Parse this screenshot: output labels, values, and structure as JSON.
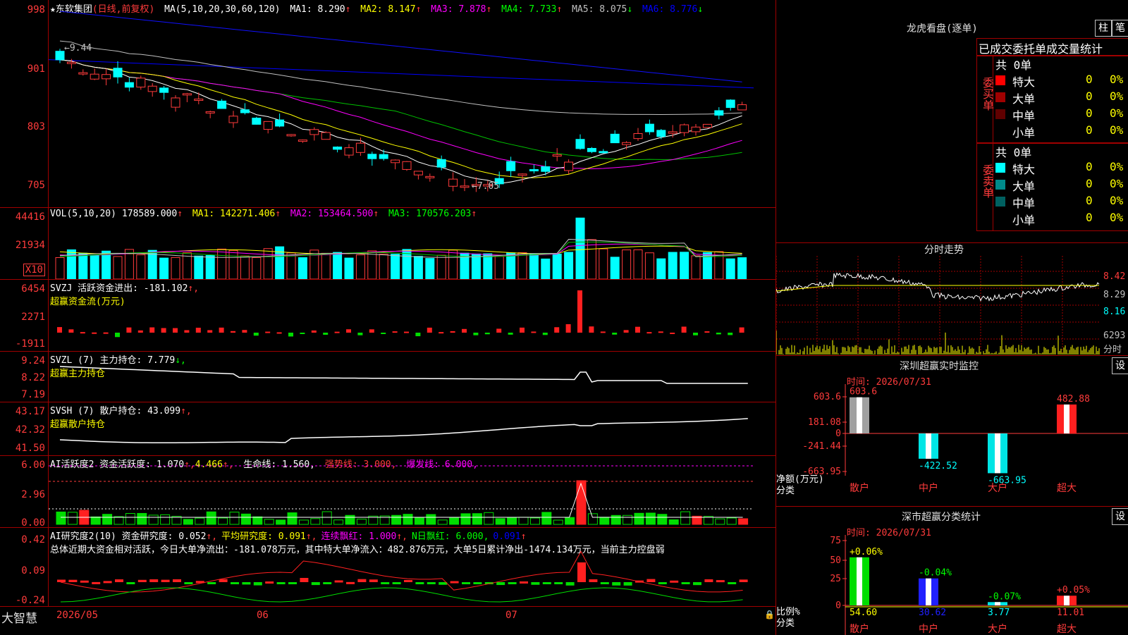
{
  "stock": {
    "name": "★东软集团",
    "mode": "(日线,前复权)"
  },
  "main_chart": {
    "ma_params": "MA(5,10,20,30,60,120)",
    "ma": [
      {
        "label": "MA1:",
        "value": "8.290",
        "arrow": "↑",
        "color": "#ffffff"
      },
      {
        "label": "MA2:",
        "value": "8.147",
        "arrow": "↑",
        "color": "#ffff00"
      },
      {
        "label": "MA3:",
        "value": "7.878",
        "arrow": "↑",
        "color": "#ff00ff"
      },
      {
        "label": "MA4:",
        "value": "7.733",
        "arrow": "↑",
        "color": "#00ff00"
      },
      {
        "label": "MA5:",
        "value": "8.075",
        "arrow": "↓",
        "color": "#c0c0c0"
      },
      {
        "label": "MA6:",
        "value": "8.776",
        "arrow": "↓",
        "color": "#0000ff"
      }
    ],
    "y_ticks": [
      "998",
      "901",
      "803",
      "705"
    ],
    "high_mark": "9.44",
    "low_mark": "7.05"
  },
  "vol": {
    "params": "VOL(5,10,20)",
    "value": "178589.000",
    "arrow": "↑",
    "ma": [
      {
        "label": "MA1:",
        "value": "142271.406",
        "arrow": "↑",
        "color": "#ffff00"
      },
      {
        "label": "MA2:",
        "value": "153464.500",
        "arrow": "↑",
        "color": "#ff00ff"
      },
      {
        "label": "MA3:",
        "value": "170576.203",
        "arrow": "↑",
        "color": "#00ff00"
      }
    ],
    "y_ticks": [
      "44416",
      "21934"
    ],
    "unit": "X10"
  },
  "svzj": {
    "title": "SVZJ  活跃资金进出: -181.102",
    "arrow": "↑,",
    "subtitle": "超赢资金流(万元)",
    "y_ticks": [
      "6454",
      "2271",
      "-1911"
    ]
  },
  "svzl": {
    "title": "SVZL (7) 主力持仓: 7.779",
    "arrow": "↓,",
    "subtitle": "超赢主力持仓",
    "y_ticks": [
      "9.24",
      "8.22",
      "7.19"
    ]
  },
  "svsh": {
    "title": "SVSH (7) 散户持仓: 43.099",
    "arrow": "↑,",
    "subtitle": "超赢散户持仓",
    "y_ticks": [
      "43.17",
      "42.32",
      "41.50"
    ]
  },
  "ai_active": {
    "title": "AI活跃度2 资金活跃度: 1.070",
    "v2": "4.466",
    "life": "生命线: 1.560,",
    "strong": "强势线: 3.000,",
    "burst": "爆发线: 6.000,",
    "y_ticks": [
      "6.00",
      "2.96",
      "0.00"
    ]
  },
  "ai_research": {
    "title": "AI研究度2(10) 资金研究度: 0.052",
    "avg": "平均研究度: 0.091",
    "cont": "连续飘红: 1.000",
    "nred": "N日飘红: 6.000,",
    "last": "0.091",
    "summary": "总体近期大资金相对活跃，今日大单净流出：-181.078万元，其中特大单净流入：482.876万元，大单5日累计净出-1474.134万元，当前主力控盘弱",
    "y_ticks": [
      "0.42",
      "0.09",
      "-0.24"
    ]
  },
  "x_axis": {
    "brand": "大智慧",
    "labels": [
      "2026/05",
      "06",
      "07"
    ]
  },
  "dragon": {
    "title": "龙虎看盘(逐单)",
    "btn1": "柱",
    "btn2": "笔",
    "tabs": [
      "已成交",
      "委托单",
      "成交量统计"
    ],
    "buy": {
      "label": "委买单",
      "total": "共 0单",
      "rows": [
        {
          "name": "特大",
          "n": "0",
          "p": "0%",
          "color": "#ff0000"
        },
        {
          "name": "大单",
          "n": "0",
          "p": "0%",
          "color": "#a00000"
        },
        {
          "name": "中单",
          "n": "0",
          "p": "0%",
          "color": "#600000"
        },
        {
          "name": "小单",
          "n": "0",
          "p": "0%",
          "color": ""
        }
      ]
    },
    "sell": {
      "label": "委卖单",
      "total": "共 0单",
      "rows": [
        {
          "name": "特大",
          "n": "0",
          "p": "0%",
          "color": "#00ffff"
        },
        {
          "name": "大单",
          "n": "0",
          "p": "0%",
          "color": "#008b8b"
        },
        {
          "name": "中单",
          "n": "0",
          "p": "0%",
          "color": "#006060"
        },
        {
          "name": "小单",
          "n": "0",
          "p": "0%",
          "color": ""
        }
      ]
    }
  },
  "intraday": {
    "title": "分时走势",
    "prices": [
      "8.42",
      "8.29",
      "8.16"
    ],
    "vol": "6293",
    "vol_unit": "分时"
  },
  "sz_monitor": {
    "title": "深圳超赢实时监控",
    "btn": "设",
    "time": "时间: 2026/07/31",
    "y_ticks": [
      "603.6",
      "181.08",
      "0",
      "-241.44",
      "-663.95"
    ],
    "ylabel1": "净额(万元)",
    "ylabel2": "分类",
    "cats": [
      "散户",
      "中户",
      "大户",
      "超大"
    ],
    "values": [
      "603.6",
      "-422.52",
      "-663.95",
      "482.88"
    ]
  },
  "sz_classify": {
    "title": "深市超赢分类统计",
    "btn": "设",
    "time": "时间: 2026/07/31",
    "y_ticks": [
      "75",
      "50",
      "25",
      "0"
    ],
    "ylabel1": "比例%",
    "ylabel2": "分类",
    "cats": [
      "散户",
      "中户",
      "大户",
      "超大"
    ],
    "values": [
      "54.60",
      "30.62",
      "3.77",
      "11.01"
    ],
    "changes": [
      "+0.06%",
      "-0.04%",
      "-0.07%",
      "+0.05%"
    ]
  },
  "chart_data": {
    "type": "bar",
    "categories": [
      "散户",
      "中户",
      "大户",
      "超大"
    ],
    "series": [
      {
        "name": "净额(万元)",
        "values": [
          603.6,
          -422.52,
          -663.95,
          482.88
        ]
      }
    ]
  }
}
